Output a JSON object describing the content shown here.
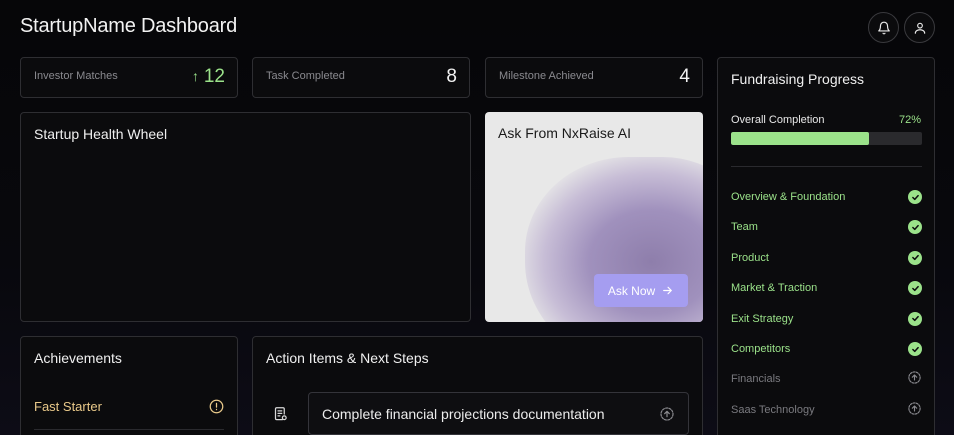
{
  "header": {
    "title": "StartupName Dashboard",
    "notifications_icon": "bell-icon",
    "profile_icon": "user-icon"
  },
  "stats": [
    {
      "label": "Investor Matches",
      "value": "12",
      "trend": "up",
      "trend_icon": "arrow-up-icon"
    },
    {
      "label": "Task Completed",
      "value": "8"
    },
    {
      "label": "Milestone Achieved",
      "value": "4"
    }
  ],
  "health_wheel": {
    "title": "Startup Health Wheel"
  },
  "ai": {
    "title": "Ask From NxRaise AI",
    "button_label": "Ask Now",
    "button_icon": "arrow-right-icon"
  },
  "fundraising": {
    "title": "Fundraising Progress",
    "overall_label": "Overall Completion",
    "overall_percent_label": "72%",
    "overall_fraction": 0.72,
    "steps": [
      {
        "label": "Overview & Foundation",
        "status": "done"
      },
      {
        "label": "Team",
        "status": "done"
      },
      {
        "label": "Product",
        "status": "done"
      },
      {
        "label": "Market & Traction",
        "status": "done"
      },
      {
        "label": "Exit Strategy",
        "status": "done"
      },
      {
        "label": "Competitors",
        "status": "done"
      },
      {
        "label": "Financials",
        "status": "pending"
      },
      {
        "label": "Saas Technology",
        "status": "pending"
      }
    ]
  },
  "achievements": {
    "title": "Achievements",
    "items": [
      {
        "label": "Fast Starter",
        "icon": "alert-circle-icon"
      }
    ]
  },
  "actions": {
    "title": "Action Items & Next Steps",
    "items": [
      {
        "label": "Complete financial projections documentation",
        "icon": "document-list-icon",
        "status_icon": "pending-upload-icon"
      }
    ]
  },
  "colors": {
    "accent_green": "#9be28a",
    "accent_purple": "#a59df0",
    "achievement_gold": "#e9c98a",
    "background": "#050508"
  }
}
